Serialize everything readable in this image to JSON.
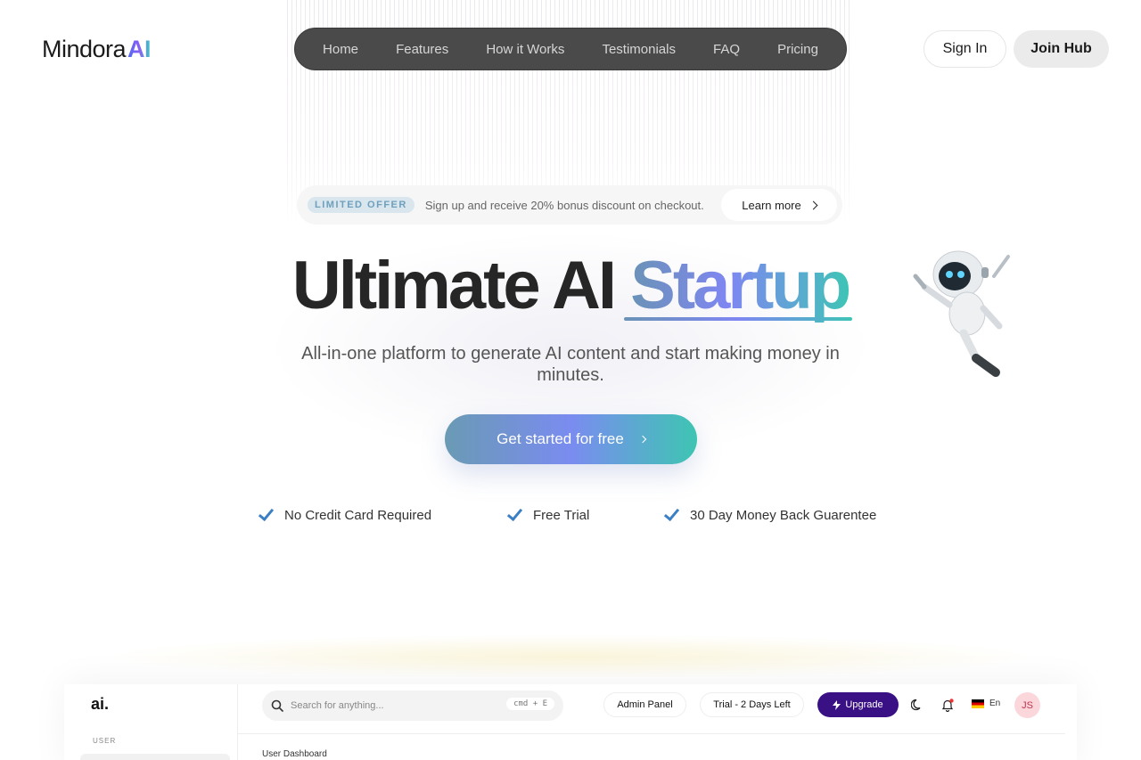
{
  "brand": {
    "name": "Mindora",
    "name_suffix": "AI"
  },
  "nav": {
    "items": [
      {
        "label": "Home"
      },
      {
        "label": "Features"
      },
      {
        "label": "How it Works"
      },
      {
        "label": "Testimonials"
      },
      {
        "label": "FAQ"
      },
      {
        "label": "Pricing"
      }
    ]
  },
  "auth": {
    "sign_in": "Sign In",
    "join": "Join Hub"
  },
  "offer": {
    "badge": "LIMITED OFFER",
    "message": "Sign up and receive 20% bonus discount on checkout.",
    "link": "Learn more"
  },
  "hero": {
    "title_plain": "Ultimate AI",
    "title_highlight": "Startup",
    "subtitle": "All-in-one platform to generate AI content and start making money in minutes.",
    "cta": "Get started for free"
  },
  "features": [
    {
      "label": "No Credit Card Required"
    },
    {
      "label": "Free Trial"
    },
    {
      "label": "30 Day Money Back Guarentee"
    }
  ],
  "dashboard": {
    "logo": "ai.",
    "section_label": "USER",
    "search_placeholder": "Search for anything...",
    "shortcut": "cmd + E",
    "admin_panel": "Admin Panel",
    "trial": "Trial - 2 Days Left",
    "upgrade": "Upgrade",
    "language": "En",
    "avatar_initials": "JS",
    "breadcrumb": "User Dashboard"
  },
  "colors": {
    "nav_bg": "#4a4a4a",
    "accent_start": "#6a93b6",
    "accent_mid": "#7f86f2",
    "accent_end": "#3fc4b6",
    "check": "#3b7fc4",
    "upgrade_bg": "#3a1085"
  }
}
